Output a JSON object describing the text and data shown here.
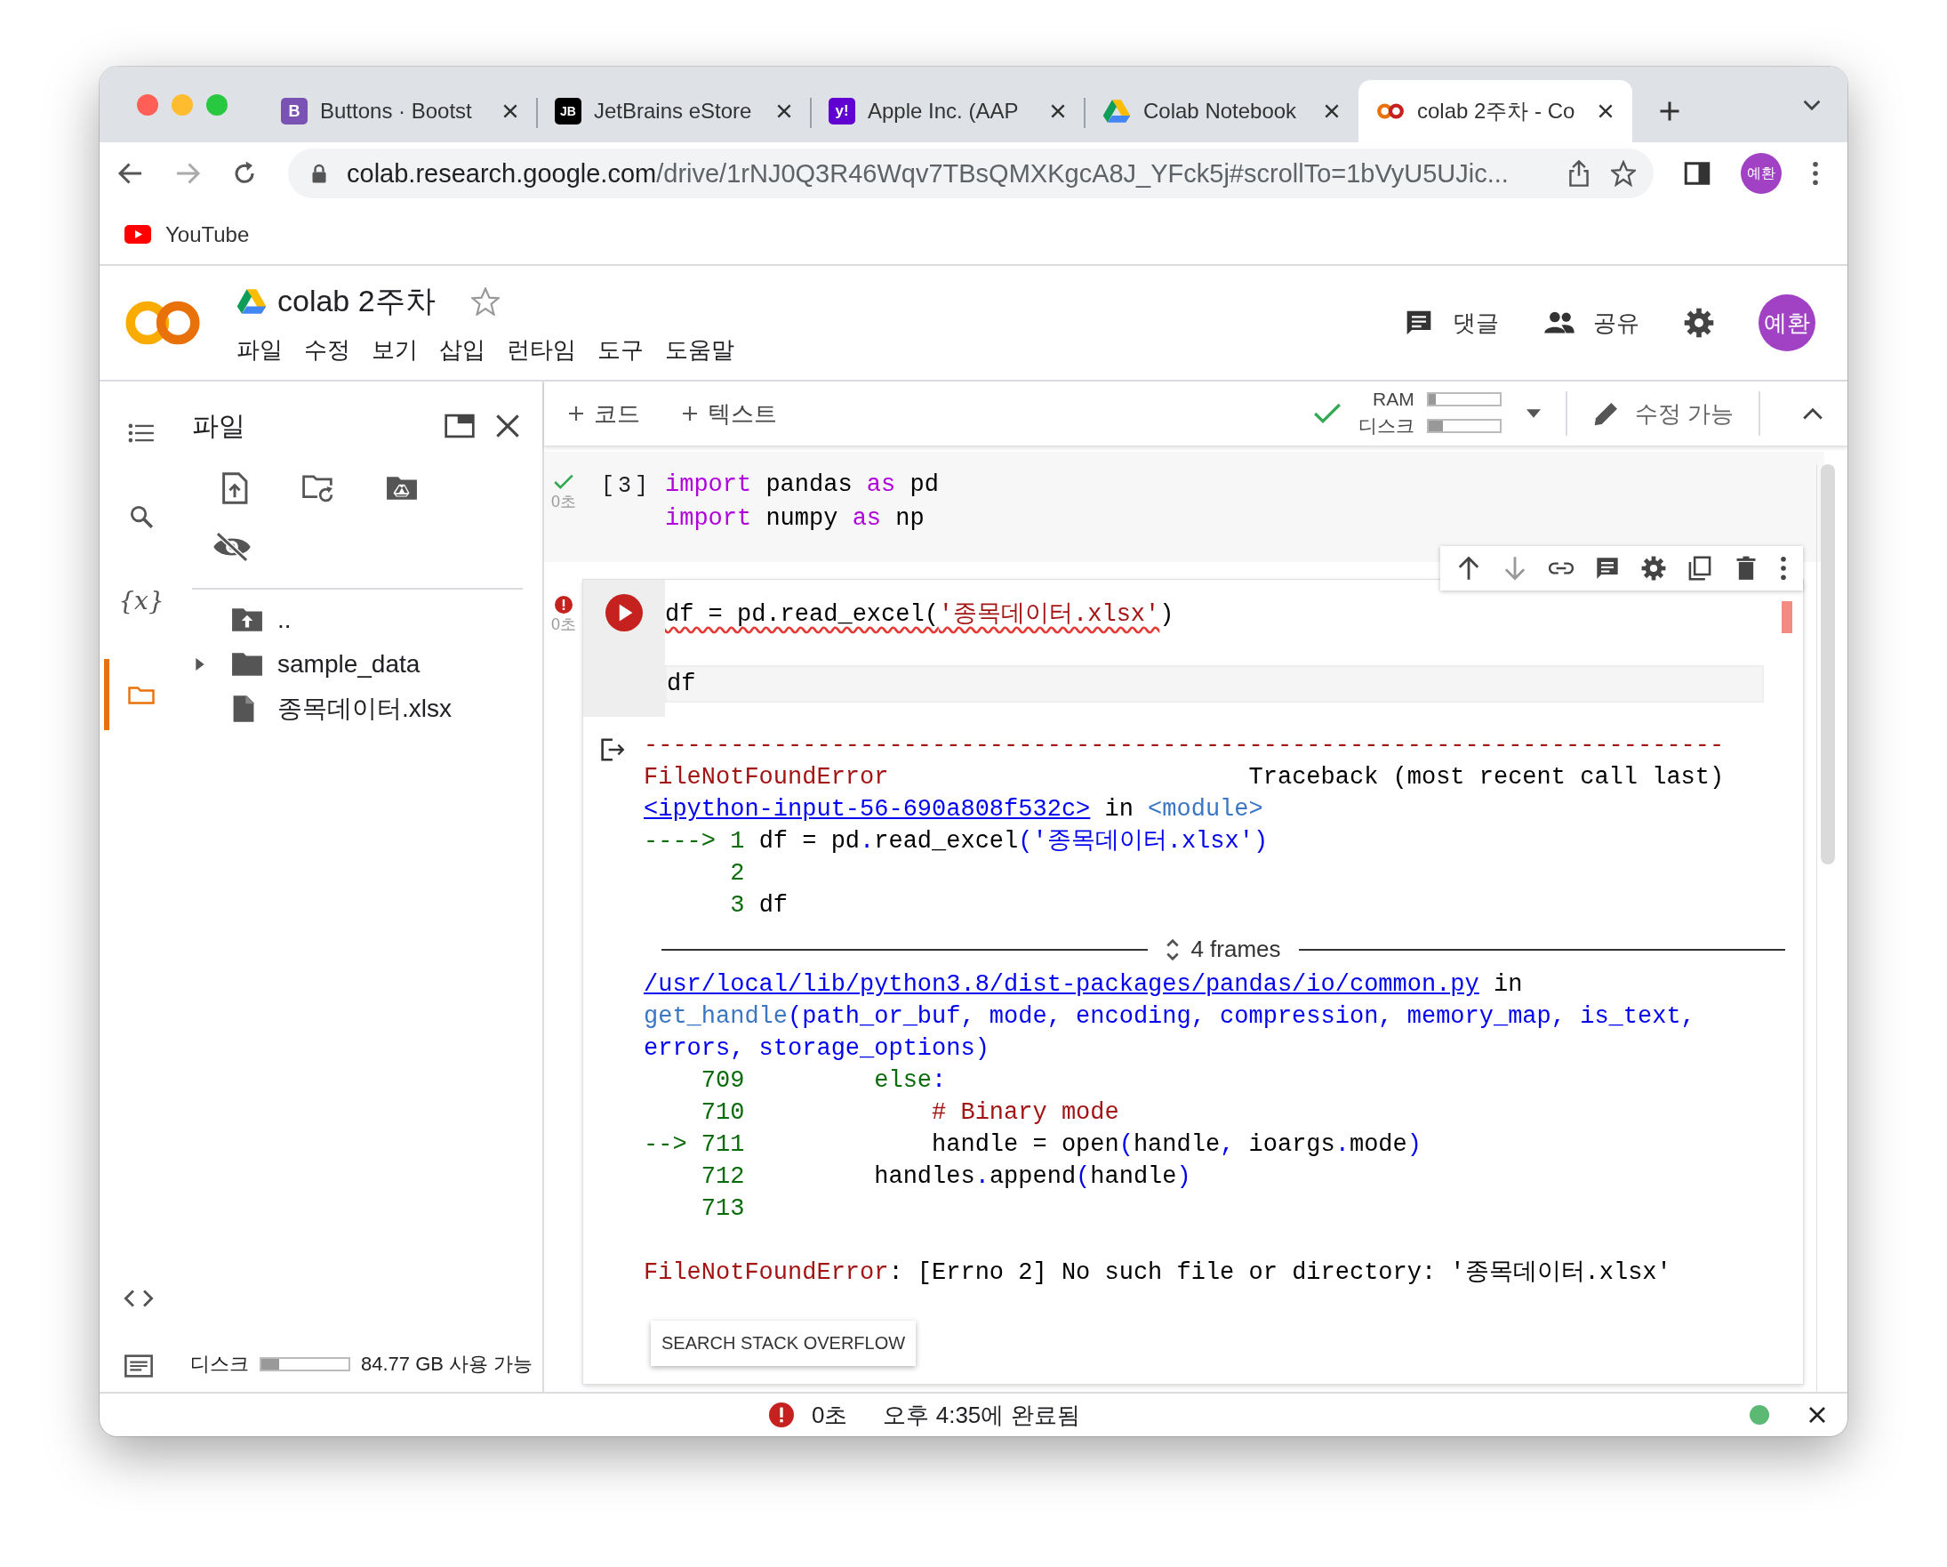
{
  "browser": {
    "tabs": [
      {
        "label": "Buttons · Bootst",
        "kind": "bootstrap",
        "badge": "B",
        "selected": false
      },
      {
        "label": "JetBrains eStore",
        "kind": "jetbrains",
        "badge": "JB",
        "selected": false
      },
      {
        "label": "Apple Inc. (AAP",
        "kind": "yahoo",
        "badge": "y!",
        "selected": false
      },
      {
        "label": "Colab Notebook",
        "kind": "drive",
        "selected": false
      },
      {
        "label": "colab 2주차 - Co",
        "kind": "colab",
        "selected": true
      }
    ],
    "url": {
      "host": "colab.research.google.com",
      "path": "/drive/1rNJ0Q3R46Wqv7TBsQMXKgcA8J_YFck5j#scrollTo=1bVyU5UJic..."
    },
    "profile": "예환",
    "bookmarks": [
      {
        "label": "YouTube"
      }
    ]
  },
  "notebook": {
    "title": "colab 2주차",
    "menu": [
      "파일",
      "수정",
      "보기",
      "삽입",
      "런타임",
      "도구",
      "도움말"
    ],
    "actions": [
      {
        "label": "댓글",
        "kind": "comment"
      },
      {
        "label": "공유",
        "kind": "share"
      }
    ],
    "avatar": "예환"
  },
  "toolbar": {
    "add": [
      "코드",
      "텍스트"
    ],
    "connected": true,
    "ram": {
      "label": "RAM",
      "level": 0.1
    },
    "disk": {
      "label": "디스크",
      "level": 0.2
    },
    "mode": "수정 가능"
  },
  "rail": [
    {
      "kind": "toc",
      "selected": false
    },
    {
      "kind": "search",
      "selected": false
    },
    {
      "kind": "variables",
      "glyph": "{x}",
      "selected": false
    },
    {
      "kind": "files",
      "selected": true
    }
  ],
  "files": {
    "title": "파일",
    "tree": [
      {
        "name": "..",
        "kind": "parent"
      },
      {
        "name": "sample_data",
        "kind": "folder",
        "expanded": false
      },
      {
        "name": "종목데이터.xlsx",
        "kind": "file"
      }
    ],
    "disk": {
      "label": "디스크",
      "level": 0.2,
      "reading": "84.77 GB 사용 가능"
    }
  },
  "cells": [
    {
      "failed": false,
      "count": "[3]",
      "time": "0초",
      "lines": [
        [
          {
            "text": "import",
            "kind": "keyword"
          },
          {
            "text": " pandas ",
            "kind": "plain"
          },
          {
            "text": "as",
            "kind": "keyword"
          },
          {
            "text": " pd",
            "kind": "plain"
          }
        ],
        [
          {
            "text": "import",
            "kind": "keyword"
          },
          {
            "text": " numpy ",
            "kind": "plain"
          },
          {
            "text": "as",
            "kind": "keyword"
          },
          {
            "text": " np",
            "kind": "plain"
          }
        ]
      ]
    },
    {
      "failed": true,
      "time": "0초",
      "lines": [
        [
          {
            "text": "df = pd.read_excel(",
            "kind": "plain",
            "squiggle": true
          },
          {
            "text": "'종목데이터.xlsx'",
            "kind": "string",
            "squiggle": true
          },
          {
            "text": ")",
            "kind": "plain",
            "squiggle": false
          }
        ],
        [
          {
            "text": "df",
            "kind": "plain",
            "squiggle": false
          }
        ]
      ],
      "output": [
        {
          "kind": "text",
          "lines": [
            [
              {
                "text": "---------------------------------------------------------------------------",
                "kind": "error"
              }
            ],
            [
              {
                "text": "FileNotFoundError",
                "kind": "error"
              },
              {
                "text": "                         Traceback (most recent call last)",
                "kind": "plain"
              }
            ],
            [
              {
                "text": "<ipython-input-56-690a808f532c>",
                "kind": "link"
              },
              {
                "text": " in ",
                "kind": "plain"
              },
              {
                "text": "<module>",
                "kind": "name"
              }
            ],
            [
              {
                "text": "----> 1 ",
                "kind": "lineno"
              },
              {
                "text": "df = pd",
                "kind": "plain"
              },
              {
                "text": ".",
                "kind": "blue"
              },
              {
                "text": "read_excel",
                "kind": "plain"
              },
              {
                "text": "('종목데이터.xlsx')",
                "kind": "blue"
              }
            ],
            [
              {
                "text": "      2",
                "kind": "lineno"
              }
            ],
            [
              {
                "text": "      3 ",
                "kind": "lineno"
              },
              {
                "text": "df",
                "kind": "plain"
              }
            ]
          ]
        },
        {
          "kind": "frames",
          "label": "4 frames"
        },
        {
          "kind": "text",
          "lines": [
            [
              {
                "text": "/usr/local/lib/python3.8/dist-packages/pandas/io/common.py",
                "kind": "link"
              },
              {
                "text": " in",
                "kind": "plain"
              }
            ],
            [
              {
                "text": "get_handle",
                "kind": "name"
              },
              {
                "text": "(path_or_buf, mode, encoding, compression, memory_map, is_text,",
                "kind": "blue"
              }
            ],
            [
              {
                "text": "errors, storage_options)",
                "kind": "blue"
              }
            ],
            [
              {
                "text": "    709         else",
                "kind": "lineno"
              },
              {
                "text": ":",
                "kind": "blue"
              }
            ],
            [
              {
                "text": "    710             ",
                "kind": "lineno"
              },
              {
                "text": "# Binary mode",
                "kind": "comment"
              }
            ],
            [
              {
                "text": "--> 711             ",
                "kind": "lineno"
              },
              {
                "text": "handle = open",
                "kind": "plain"
              },
              {
                "text": "(",
                "kind": "blue"
              },
              {
                "text": "handle",
                "kind": "plain"
              },
              {
                "text": ",",
                "kind": "blue"
              },
              {
                "text": " ioargs",
                "kind": "plain"
              },
              {
                "text": ".",
                "kind": "blue"
              },
              {
                "text": "mode",
                "kind": "plain"
              },
              {
                "text": ")",
                "kind": "blue"
              }
            ],
            [
              {
                "text": "    712         ",
                "kind": "lineno"
              },
              {
                "text": "handles",
                "kind": "plain"
              },
              {
                "text": ".",
                "kind": "blue"
              },
              {
                "text": "append",
                "kind": "plain"
              },
              {
                "text": "(",
                "kind": "blue"
              },
              {
                "text": "handle",
                "kind": "plain"
              },
              {
                "text": ")",
                "kind": "blue"
              }
            ],
            [
              {
                "text": "    713",
                "kind": "lineno"
              }
            ]
          ]
        },
        {
          "kind": "error",
          "lines": [
            [
              {
                "text": "FileNotFoundError",
                "kind": "error"
              },
              {
                "text": ": [Errno 2] No such file or directory: '종목데이터.xlsx'",
                "kind": "plain"
              }
            ]
          ]
        },
        {
          "kind": "button",
          "label": "SEARCH STACK OVERFLOW"
        }
      ]
    }
  ],
  "status": {
    "failed": true,
    "time": "0초",
    "message": "오후 4:35에 완료됨",
    "connected": true
  }
}
